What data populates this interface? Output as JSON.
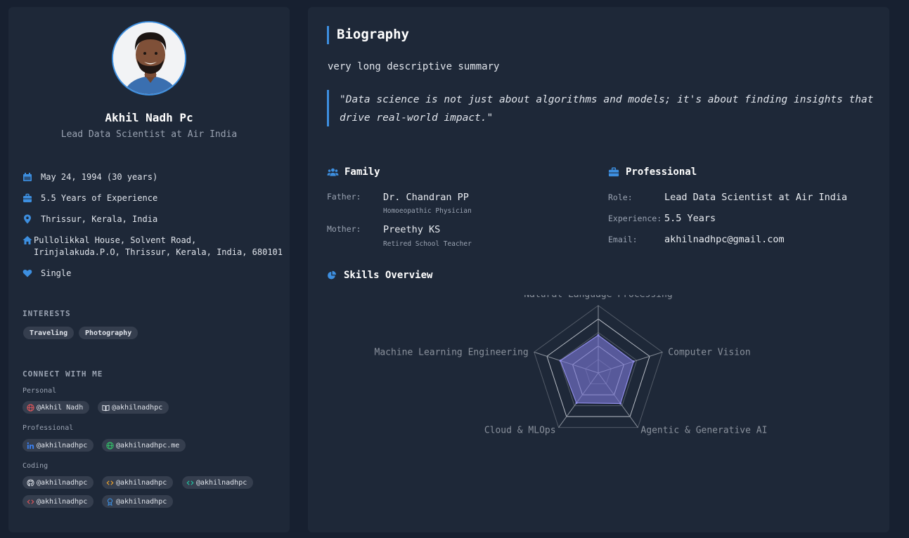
{
  "profile": {
    "name": "Akhil Nadh Pc",
    "title": "Lead Data Scientist at Air India",
    "details": {
      "dob": "May 24, 1994 (30 years)",
      "experience": "5.5 Years of Experience",
      "location": "Thrissur, Kerala, India",
      "address_line1": "Pullolikkal House, Solvent Road,",
      "address_line2": "Irinjalakuda.P.O, Thrissur, Kerala, India, 680101",
      "status": "Single"
    },
    "interests_heading": "INTERESTS",
    "interests": [
      "Traveling",
      "Photography"
    ],
    "connect_heading": "CONNECT WITH ME",
    "personal_label": "Personal",
    "professional_label": "Professional",
    "coding_label": "Coding",
    "personal_links": [
      {
        "icon": "globe-icon",
        "text": "@Akhil Nadh",
        "color": "#e0565b"
      },
      {
        "icon": "book-icon",
        "text": "@akhilnadhpc",
        "color": "#dfe3ea"
      }
    ],
    "professional_links": [
      {
        "icon": "linkedin-icon",
        "text": "@akhilnadhpc",
        "color": "#3b82f6"
      },
      {
        "icon": "globe-icon",
        "text": "@akhilnadhpc.me",
        "color": "#34c46a"
      }
    ],
    "coding_links": [
      {
        "icon": "github-icon",
        "text": "@akhilnadhpc",
        "color": "#dfe3ea"
      },
      {
        "icon": "code-icon",
        "text": "@akhilnadhpc",
        "color": "#f0a52c"
      },
      {
        "icon": "code-icon",
        "text": "@akhilnadhpc",
        "color": "#20c7a4"
      },
      {
        "icon": "code-icon",
        "text": "@akhilnadhpc",
        "color": "#e0565b"
      },
      {
        "icon": "award-icon",
        "text": "@akhilnadhpc",
        "color": "#3d8fe0"
      }
    ]
  },
  "biography": {
    "heading": "Biography",
    "summary": "very long descriptive summary",
    "quote": "\"Data science is not just about algorithms and models; it's about finding insights that drive real-world impact.\""
  },
  "family": {
    "heading": "Family",
    "father_label": "Father:",
    "father_name": "Dr. Chandran PP",
    "father_note": "Homoeopathic Physician",
    "mother_label": "Mother:",
    "mother_name": "Preethy KS",
    "mother_note": "Retired School Teacher"
  },
  "professional": {
    "heading": "Professional",
    "role_label": "Role:",
    "role": "Lead Data Scientist at Air India",
    "experience_label": "Experience:",
    "experience": "5.5 Years",
    "email_label": "Email:",
    "email": "akhilnadhpc@gmail.com"
  },
  "skills": {
    "heading": "Skills Overview",
    "accent_color": "#7b78d6"
  },
  "chart_data": {
    "type": "radar",
    "categories": [
      "Natural Language Processing",
      "Computer Vision",
      "Agentic & Generative AI",
      "Cloud & MLOps",
      "Machine Learning Engineering"
    ],
    "values": [
      0.56,
      0.55,
      0.56,
      0.55,
      0.59
    ],
    "max": 1
  }
}
